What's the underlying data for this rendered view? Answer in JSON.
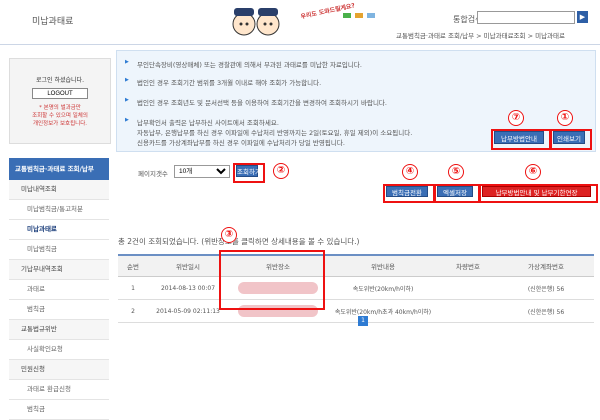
{
  "header": {
    "page_title": "미납과태료",
    "slogan": "우리도 도와드릴게요?",
    "search_label": "통합검색",
    "search_placeholder": "",
    "search_button": "▶",
    "breadcrumb": "교통범칙금·과태료 조회/납부 > 미납과태료조회 > 미납과태료"
  },
  "login": {
    "message": "로그인 하셨습니다.",
    "logout_button": "LOGOUT",
    "note_lines": [
      "* 본명의 벌과금만",
      "조회할 수 있으며 일체의",
      "개인정보가 보호됩니다."
    ]
  },
  "sidebar": {
    "heading": "교통범칙금·과태료 조회/납부",
    "items": [
      {
        "label": "미납내역조회",
        "level": "top"
      },
      {
        "label": "미납범칙금/통고처분",
        "level": "sub"
      },
      {
        "label": "미납과태료",
        "level": "sub",
        "active": true
      },
      {
        "label": "미납범칙금",
        "level": "sub"
      },
      {
        "label": "기납부내역조회",
        "level": "top"
      },
      {
        "label": "과태료",
        "level": "sub"
      },
      {
        "label": "범칙금",
        "level": "sub"
      },
      {
        "label": "교통법규위반",
        "level": "top"
      },
      {
        "label": "사실확인요청",
        "level": "sub"
      },
      {
        "label": "민원신청",
        "level": "top"
      },
      {
        "label": "과태료 환급신청",
        "level": "sub"
      },
      {
        "label": "범칙금",
        "level": "sub"
      }
    ]
  },
  "notice": {
    "items": [
      "무인단속장비(영상매체) 또는 경찰관에 의해서 부과된 과태료를 미납한 자료입니다.",
      "법인인 경우 조회기간 범위를 3개월 이내로 해야 조회가 가능합니다.",
      "법인인 경우 조회년도 및 문서선택 등을 이용하여 조회기간을 변경하여 조회하시기 바랍니다.",
      "납부확인서 출력은 납부하신 사이트에서 조회하세요."
    ],
    "sub_lines": [
      "자동납부, 은행납부를 하신 경우 이파일에 수납처리 반영까지는 2일(토요일, 휴일 제외)이 소요됩니다.",
      "신용카드를 가상계좌납부를 하신 경우 이파일에 수납처리가 당일 반영됩니다."
    ]
  },
  "buttons": {
    "payment_guide": "납부방법안내",
    "print_list": "인쇄보기",
    "search": "조회하기",
    "convert_fine": "범칙금전환",
    "save_excel": "엑셀저장",
    "deadline_extension": "납부방법안내 및 납부기한연장"
  },
  "toolbar": {
    "perpage_label": "페이지갯수",
    "perpage_value": "10개"
  },
  "annotations": [
    "①",
    "②",
    "③",
    "④",
    "⑤",
    "⑥",
    "⑦"
  ],
  "result_text": "총 2건이 조회되었습니다. (위반장소를 클릭하면 상세내용을 볼 수 있습니다.)",
  "table": {
    "headers": [
      "순번",
      "위반일시",
      "위반장소",
      "위반내용",
      "차량번호",
      "가상계좌번호"
    ],
    "rows": [
      [
        "1",
        "2014-08-13 00:07",
        "",
        "속도위반(20km/h이하)",
        "",
        "(신한은행) 56"
      ],
      [
        "2",
        "2014-05-09 02:11:13",
        "",
        "속도위반(20km/h초과 40km/h이하)",
        "",
        "(신한은행) 56"
      ]
    ]
  },
  "pagination": {
    "current": "1"
  },
  "colors": {
    "accent": "#3a6eb5",
    "highlight": "#e11111",
    "notice_bg": "#eef5fc"
  }
}
